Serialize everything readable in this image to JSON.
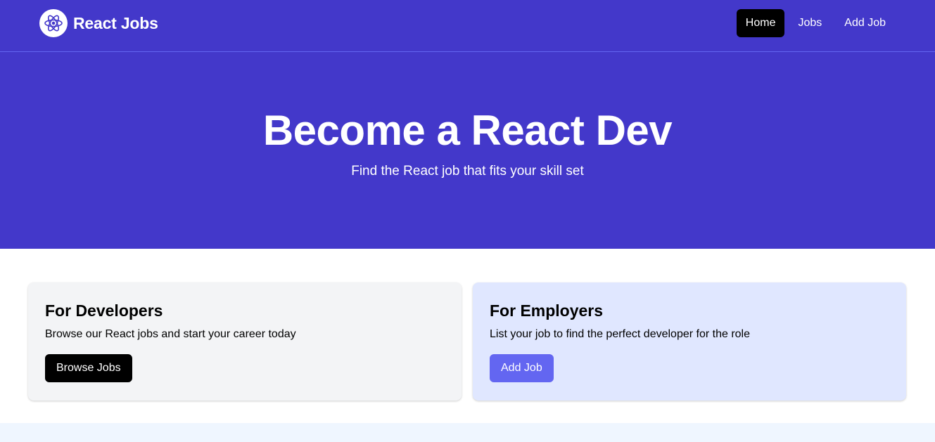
{
  "navbar": {
    "brand": "React Jobs",
    "logo_icon": "react-atom-icon",
    "links": [
      {
        "label": "Home",
        "active": true
      },
      {
        "label": "Jobs",
        "active": false
      },
      {
        "label": "Add Job",
        "active": false
      }
    ]
  },
  "hero": {
    "title": "Become a React Dev",
    "subtitle": "Find the React job that fits your skill set"
  },
  "cards": {
    "developers": {
      "title": "For Developers",
      "text": "Browse our React jobs and start your career today",
      "button": "Browse Jobs"
    },
    "employers": {
      "title": "For Employers",
      "text": "List your job to find the perfect developer for the role",
      "button": "Add Job"
    }
  },
  "colors": {
    "brand": "#4338ca",
    "active_nav": "#000000",
    "developers_card": "#f3f4f6",
    "employers_card": "#e0e7ff",
    "employers_button": "#6366f1"
  }
}
